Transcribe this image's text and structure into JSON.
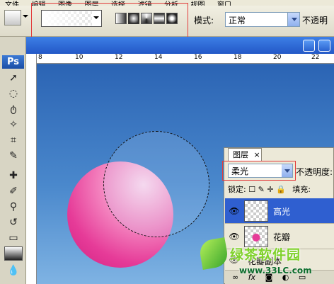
{
  "menubar": {
    "items": [
      "文件",
      "编辑",
      "图像",
      "图层",
      "选择",
      "滤镜",
      "分析",
      "视图",
      "窗口"
    ]
  },
  "options": {
    "mode_label": "模式:",
    "mode_value": "正常",
    "opacity_label": "不透明",
    "gradient_types": [
      "linear",
      "radial",
      "angle",
      "reflected",
      "diamond"
    ]
  },
  "app": {
    "logo": "Ps"
  },
  "toolbox": {
    "tools": [
      "move-tool",
      "marquee-tool",
      "lasso-tool",
      "magic-wand-tool",
      "crop-tool",
      "eyedropper-tool",
      "healing-tool",
      "brush-tool",
      "stamp-tool",
      "history-brush-tool",
      "eraser-tool",
      "gradient-tool",
      "blur-tool"
    ]
  },
  "ruler": {
    "numbers": [
      "8",
      "10",
      "12",
      "14",
      "16",
      "18",
      "20",
      "22"
    ]
  },
  "layers": {
    "tab": "图层",
    "tab_close": "×",
    "blend_mode": "柔光",
    "opacity_label": "不透明度:",
    "lock_label": "锁定:",
    "fill_label": "填充:",
    "items": [
      {
        "name": "高光",
        "selected": true
      },
      {
        "name": "花瓣",
        "selected": false
      },
      {
        "name": "花瓣副本",
        "selected": false
      }
    ]
  },
  "watermark": {
    "title": "绿茶软件园",
    "url": "www.33LC.com"
  },
  "colors": {
    "accent_select": "#2f5fd0",
    "pink": "#e63b98",
    "red_outline": "#e23b3b"
  }
}
